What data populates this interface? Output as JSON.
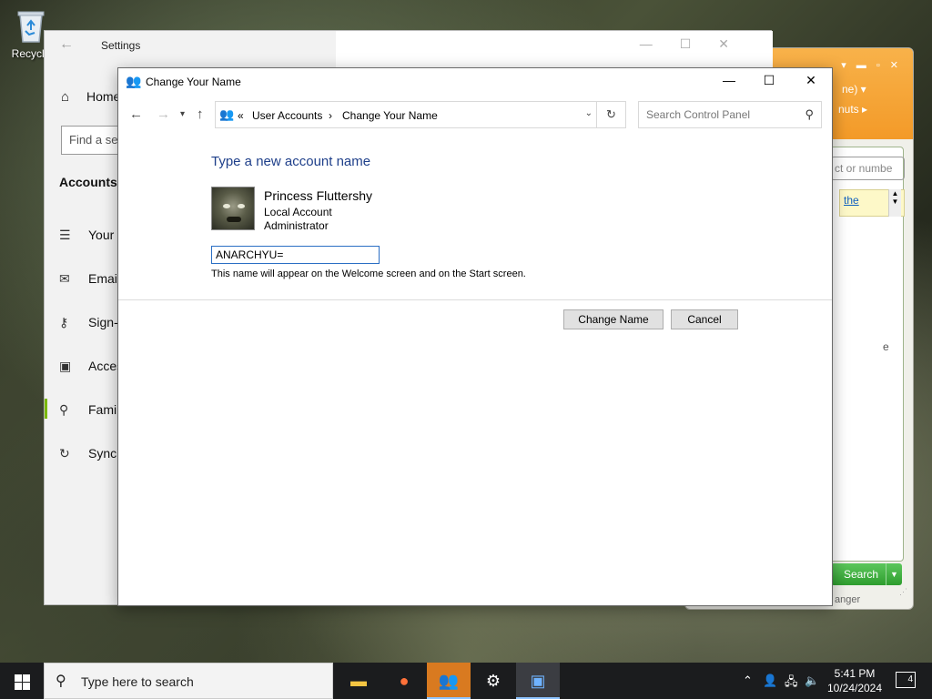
{
  "desktop": {
    "icon_label": "Recycle"
  },
  "messenger": {
    "header_line1": "ne)",
    "header_line2": "nuts",
    "search_placeholder": "ct or numbe",
    "link_text": "the",
    "partial_char": "e",
    "search_button": "Search",
    "footer_text": "anger"
  },
  "settings": {
    "title": "Settings",
    "home_label": "Home",
    "find_placeholder": "Find a se",
    "section_title": "Accounts",
    "nav_items": [
      {
        "label": "Your i",
        "icon": "person-card-icon"
      },
      {
        "label": "Email",
        "icon": "mail-icon"
      },
      {
        "label": "Sign-i",
        "icon": "key-icon"
      },
      {
        "label": "Acces",
        "icon": "briefcase-icon"
      },
      {
        "label": "Family",
        "icon": "person-add-icon"
      },
      {
        "label": "Sync y",
        "icon": "sync-icon"
      }
    ]
  },
  "dialog": {
    "title": "Change Your Name",
    "breadcrumb_overflow": "«",
    "breadcrumb": [
      "User Accounts",
      "Change Your Name"
    ],
    "breadcrumb_separator": "›",
    "search_placeholder": "Search Control Panel",
    "heading": "Type a new account name",
    "user": {
      "name": "Princess Fluttershy",
      "account_type": "Local Account",
      "role": "Administrator"
    },
    "new_name_value": "ANARCHYU=",
    "hint": "This name will appear on the Welcome screen and on the Start screen.",
    "change_button": "Change Name",
    "cancel_button": "Cancel"
  },
  "taskbar": {
    "search_placeholder": "Type here to search",
    "apps": [
      "file-explorer-icon",
      "firefox-icon",
      "messenger-icon",
      "settings-gear-icon",
      "control-panel-icon"
    ],
    "time": "5:41 PM",
    "date": "10/24/2024",
    "notification_count": "4"
  }
}
